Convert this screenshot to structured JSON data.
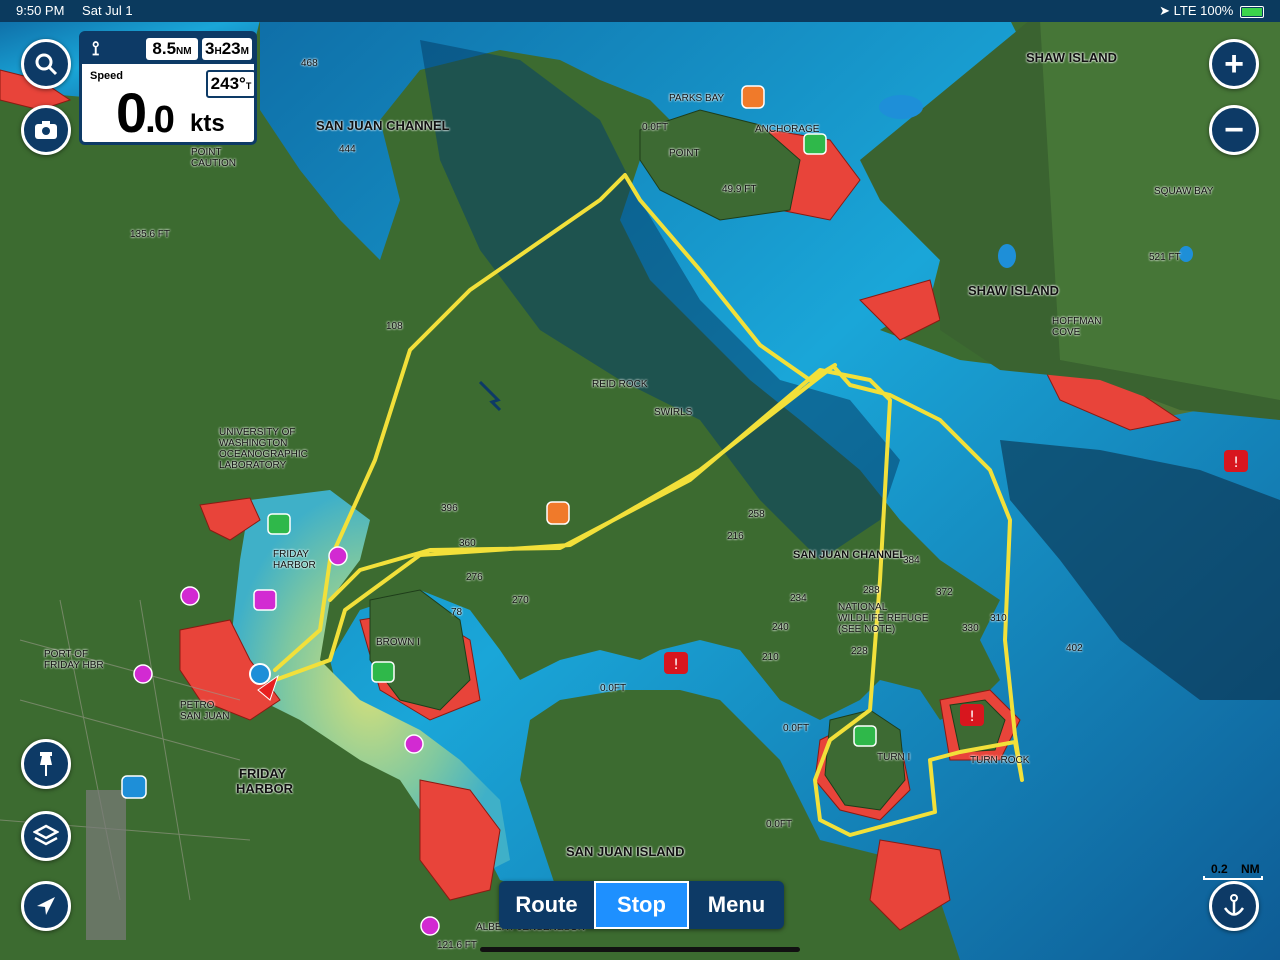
{
  "status_bar": {
    "time": "9:50 PM",
    "date": "Sat Jul 1",
    "signal": "LTE 100%"
  },
  "gauge": {
    "distance_value": "8.5",
    "distance_unit": "NM",
    "eta_hours": "3",
    "eta_minutes": "23",
    "eta_h_unit": "H",
    "eta_m_unit": "M",
    "speed_label": "Speed",
    "speed_whole": "0",
    "speed_frac": ".0",
    "speed_unit": "kts",
    "cog_value": "243°",
    "cog_unit": "T"
  },
  "buttons": {
    "search_icon": "search-icon",
    "camera_icon": "camera-icon",
    "zoom_in": "+",
    "zoom_out": "−",
    "pin_icon": "pin-icon",
    "layers_icon": "layers-icon",
    "locate_icon": "location-arrow-icon",
    "anchor_icon": "anchor-alarm-icon"
  },
  "bottom_bar": {
    "route": "Route",
    "stop": "Stop",
    "menu": "Menu"
  },
  "scale": {
    "value": "0.2",
    "unit": "NM"
  },
  "labels": {
    "san_juan_channel_n": "SAN JUAN CHANNEL",
    "san_juan_channel_s": "SAN JUAN CHANNEL",
    "shaw_island": "SHAW ISLAND",
    "shaw_island_top": "SHAW ISLAND",
    "parks_bay": "PARKS BAY",
    "anchorage": "ANCHORAGE",
    "point": "POINT",
    "squaw_bay": "SQUAW BAY",
    "hoffman_cove_1": "HOFFMAN",
    "hoffman_cove_2": "COVE",
    "point_caution_1": "POINT",
    "point_caution_2": "CAUTION",
    "univ_1": "UNIVERSITY OF",
    "univ_2": "WASHINGTON",
    "univ_3": "OCEANOGRAPHIC",
    "univ_4": "LABORATORY",
    "friday_harbor_water_1": "FRIDAY",
    "friday_harbor_water_2": "HARBOR",
    "friday_harbor_town_1": "FRIDAY",
    "friday_harbor_town_2": "HARBOR",
    "port_1": "PORT OF",
    "port_2": "FRIDAY HBR",
    "petro_1": "PETRO",
    "petro_2": "SAN JUAN",
    "brown_i": "BROWN I",
    "san_juan_island": "SAN JUAN ISLAND",
    "turn_i": "TURN I",
    "turn_rock": "TURN ROCK",
    "refuge_1": "NATIONAL",
    "refuge_2": "WILDLIFE REFUGE",
    "refuge_3": "(SEE NOTE)",
    "reid_rock": "REID ROCK",
    "swirls": "SWIRLS",
    "albert": "ALBERT JENSEN&SON",
    "depth_135": "135.6 FT",
    "depth_49": "49.9 FT",
    "depth_521": "521 FT",
    "depth_1216": "121.6 FT",
    "depth_0a": "0.0FT",
    "depth_0b": "0.0FT",
    "depth_0c": "0.0FT",
    "depth_0d": "0.0FT",
    "snd_396": "396",
    "snd_360": "360",
    "snd_276": "276",
    "snd_270": "270",
    "snd_258": "258",
    "snd_216": "216",
    "snd_234": "234",
    "snd_240": "240",
    "snd_210": "210",
    "snd_288": "288",
    "snd_384": "384",
    "snd_372": "372",
    "snd_330": "330",
    "snd_310": "310",
    "snd_444": "444",
    "snd_468": "468",
    "snd_402": "402",
    "snd_228": "228",
    "snd_78": "78",
    "snd_108": "108"
  },
  "colors": {
    "track": "#f2e03a",
    "shallow": "#e8443a",
    "deep": "#1aa6d8",
    "land": "#3c6b30",
    "ui": "#0d3a66"
  }
}
